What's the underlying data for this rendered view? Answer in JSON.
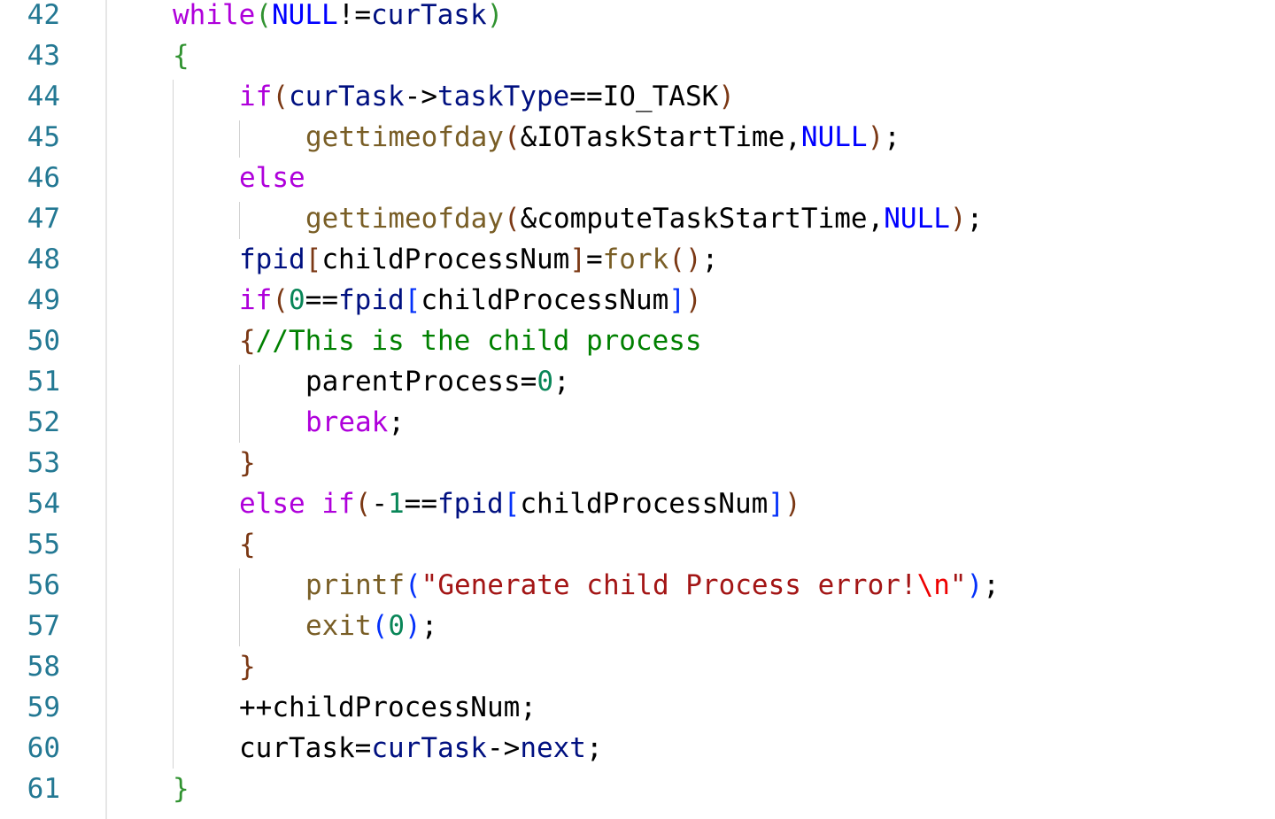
{
  "editor": {
    "colors": {
      "keyword": "#af00db",
      "function": "#795e26",
      "variable": "#001080",
      "constant": "#0000ff",
      "number": "#098658",
      "string": "#a31515",
      "escape": "#ee0000",
      "comment": "#008000",
      "plain": "#000000",
      "bracket1": "#319331",
      "bracket2": "#7b3814",
      "bracket3": "#0431fa",
      "line_number": "#237893"
    },
    "lines": [
      {
        "number": "42",
        "indent": 1,
        "tokens": [
          {
            "t": "while",
            "c": "keyword"
          },
          {
            "t": "(",
            "c": "bracket1"
          },
          {
            "t": "NULL",
            "c": "constant"
          },
          {
            "t": "!=",
            "c": "plain"
          },
          {
            "t": "curTask",
            "c": "variable"
          },
          {
            "t": ")",
            "c": "bracket1"
          }
        ]
      },
      {
        "number": "43",
        "indent": 1,
        "tokens": [
          {
            "t": "{",
            "c": "bracket1"
          }
        ]
      },
      {
        "number": "44",
        "indent": 2,
        "tokens": [
          {
            "t": "if",
            "c": "keyword"
          },
          {
            "t": "(",
            "c": "bracket2"
          },
          {
            "t": "curTask",
            "c": "variable"
          },
          {
            "t": "->",
            "c": "plain"
          },
          {
            "t": "taskType",
            "c": "variable"
          },
          {
            "t": "==",
            "c": "plain"
          },
          {
            "t": "IO_TASK",
            "c": "plain"
          },
          {
            "t": ")",
            "c": "bracket2"
          }
        ]
      },
      {
        "number": "45",
        "indent": 3,
        "tokens": [
          {
            "t": "gettimeofday",
            "c": "function"
          },
          {
            "t": "(",
            "c": "bracket2"
          },
          {
            "t": "&IOTaskStartTime,",
            "c": "plain"
          },
          {
            "t": "NULL",
            "c": "constant"
          },
          {
            "t": ")",
            "c": "bracket2"
          },
          {
            "t": ";",
            "c": "plain"
          }
        ]
      },
      {
        "number": "46",
        "indent": 2,
        "tokens": [
          {
            "t": "else",
            "c": "keyword"
          }
        ]
      },
      {
        "number": "47",
        "indent": 3,
        "tokens": [
          {
            "t": "gettimeofday",
            "c": "function"
          },
          {
            "t": "(",
            "c": "bracket2"
          },
          {
            "t": "&computeTaskStartTime,",
            "c": "plain"
          },
          {
            "t": "NULL",
            "c": "constant"
          },
          {
            "t": ")",
            "c": "bracket2"
          },
          {
            "t": ";",
            "c": "plain"
          }
        ]
      },
      {
        "number": "48",
        "indent": 2,
        "tokens": [
          {
            "t": "fpid",
            "c": "variable"
          },
          {
            "t": "[",
            "c": "bracket2"
          },
          {
            "t": "childProcessNum",
            "c": "plain"
          },
          {
            "t": "]",
            "c": "bracket2"
          },
          {
            "t": "=",
            "c": "plain"
          },
          {
            "t": "fork",
            "c": "function"
          },
          {
            "t": "()",
            "c": "bracket2"
          },
          {
            "t": ";",
            "c": "plain"
          }
        ]
      },
      {
        "number": "49",
        "indent": 2,
        "tokens": [
          {
            "t": "if",
            "c": "keyword"
          },
          {
            "t": "(",
            "c": "bracket2"
          },
          {
            "t": "0",
            "c": "number"
          },
          {
            "t": "==",
            "c": "plain"
          },
          {
            "t": "fpid",
            "c": "variable"
          },
          {
            "t": "[",
            "c": "bracket3"
          },
          {
            "t": "childProcessNum",
            "c": "plain"
          },
          {
            "t": "]",
            "c": "bracket3"
          },
          {
            "t": ")",
            "c": "bracket2"
          }
        ]
      },
      {
        "number": "50",
        "indent": 2,
        "tokens": [
          {
            "t": "{",
            "c": "bracket2"
          },
          {
            "t": "//This is the child process",
            "c": "comment"
          }
        ]
      },
      {
        "number": "51",
        "indent": 3,
        "tokens": [
          {
            "t": "parentProcess",
            "c": "plain"
          },
          {
            "t": "=",
            "c": "plain"
          },
          {
            "t": "0",
            "c": "number"
          },
          {
            "t": ";",
            "c": "plain"
          }
        ]
      },
      {
        "number": "52",
        "indent": 3,
        "tokens": [
          {
            "t": "break",
            "c": "keyword"
          },
          {
            "t": ";",
            "c": "plain"
          }
        ]
      },
      {
        "number": "53",
        "indent": 2,
        "tokens": [
          {
            "t": "}",
            "c": "bracket2"
          }
        ]
      },
      {
        "number": "54",
        "indent": 2,
        "tokens": [
          {
            "t": "else",
            "c": "keyword"
          },
          {
            "t": " ",
            "c": "plain"
          },
          {
            "t": "if",
            "c": "keyword"
          },
          {
            "t": "(",
            "c": "bracket2"
          },
          {
            "t": "-",
            "c": "plain"
          },
          {
            "t": "1",
            "c": "number"
          },
          {
            "t": "==",
            "c": "plain"
          },
          {
            "t": "fpid",
            "c": "variable"
          },
          {
            "t": "[",
            "c": "bracket3"
          },
          {
            "t": "childProcessNum",
            "c": "plain"
          },
          {
            "t": "]",
            "c": "bracket3"
          },
          {
            "t": ")",
            "c": "bracket2"
          }
        ]
      },
      {
        "number": "55",
        "indent": 2,
        "tokens": [
          {
            "t": "{",
            "c": "bracket2"
          }
        ]
      },
      {
        "number": "56",
        "indent": 3,
        "tokens": [
          {
            "t": "printf",
            "c": "function"
          },
          {
            "t": "(",
            "c": "bracket3"
          },
          {
            "t": "\"Generate child Process error!",
            "c": "string"
          },
          {
            "t": "\\n",
            "c": "escape"
          },
          {
            "t": "\"",
            "c": "string"
          },
          {
            "t": ")",
            "c": "bracket3"
          },
          {
            "t": ";",
            "c": "plain"
          }
        ]
      },
      {
        "number": "57",
        "indent": 3,
        "tokens": [
          {
            "t": "exit",
            "c": "function"
          },
          {
            "t": "(",
            "c": "bracket3"
          },
          {
            "t": "0",
            "c": "number"
          },
          {
            "t": ")",
            "c": "bracket3"
          },
          {
            "t": ";",
            "c": "plain"
          }
        ]
      },
      {
        "number": "58",
        "indent": 2,
        "tokens": [
          {
            "t": "}",
            "c": "bracket2"
          }
        ]
      },
      {
        "number": "59",
        "indent": 2,
        "tokens": [
          {
            "t": "++childProcessNum;",
            "c": "plain"
          }
        ]
      },
      {
        "number": "60",
        "indent": 2,
        "tokens": [
          {
            "t": "curTask",
            "c": "plain"
          },
          {
            "t": "=",
            "c": "plain"
          },
          {
            "t": "curTask",
            "c": "variable"
          },
          {
            "t": "->",
            "c": "plain"
          },
          {
            "t": "next",
            "c": "variable"
          },
          {
            "t": ";",
            "c": "plain"
          }
        ]
      },
      {
        "number": "61",
        "indent": 1,
        "tokens": [
          {
            "t": "}",
            "c": "bracket1"
          }
        ]
      }
    ]
  }
}
